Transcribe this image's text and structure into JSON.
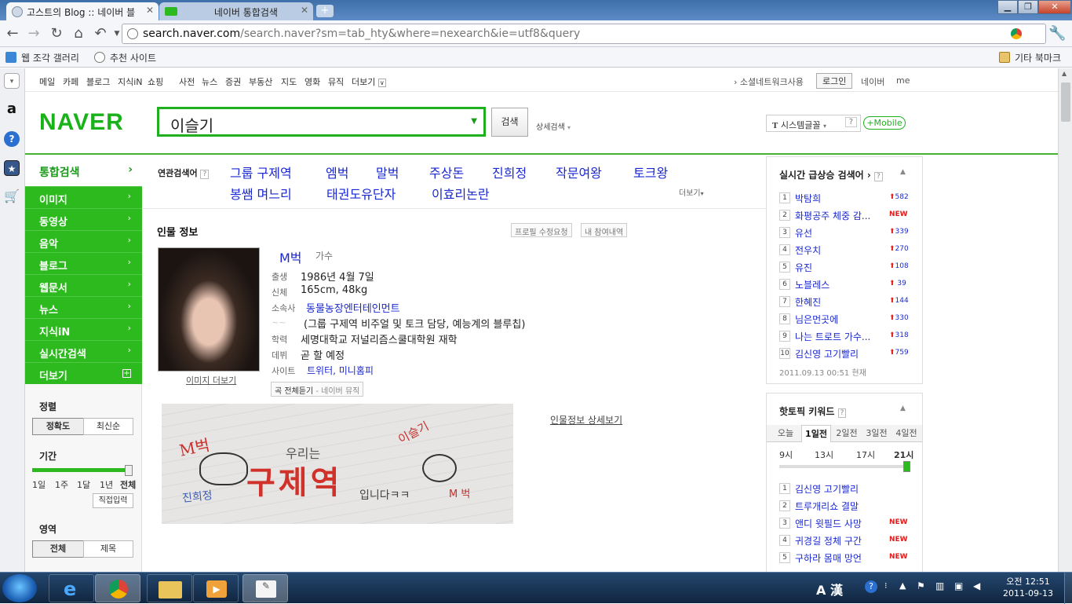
{
  "browser": {
    "tabs": [
      {
        "title": "고스트의 Blog :: 네이버 블",
        "active": true
      },
      {
        "title": "네이버 통합검색",
        "active": false
      }
    ],
    "tab_prefix_hidden": "▭",
    "url_host": "search.naver.com",
    "url_path": "/search.naver?sm=tab_hty&where=nexearch&ie=utf8&query",
    "bookmarks": [
      "웹 조각 갤러리",
      "추천 사이트"
    ],
    "other_bookmarks": "기타 북마크"
  },
  "gnb": {
    "items": [
      "메일",
      "카페",
      "블로그",
      "지식iN",
      "쇼핑",
      "사전",
      "뉴스",
      "증권",
      "부동산",
      "지도",
      "영화",
      "뮤직",
      "더보기"
    ],
    "social": "소셜네트워크사용",
    "login": "로그인",
    "naver": "네이버",
    "me": "me"
  },
  "header": {
    "logo": "NAVER",
    "query": "이슬기",
    "search_button": "검색",
    "detail_search": "상세검색",
    "font_select": "시스템글꼴",
    "help": "?",
    "mobile": "+Mobile"
  },
  "lnb": {
    "top": "통합검색",
    "items": [
      "이미지",
      "동영상",
      "음악",
      "블로그",
      "웹문서",
      "뉴스",
      "지식iN",
      "실시간검색",
      "더보기"
    ],
    "sort_label": "정렬",
    "sort_options": [
      "정확도",
      "최신순"
    ],
    "period_label": "기간",
    "period_ticks": [
      "1일",
      "1주",
      "1달",
      "1년",
      "전체"
    ],
    "direct_input": "직접입력",
    "area_label": "영역",
    "area_options": [
      "전체",
      "제목"
    ]
  },
  "related": {
    "label": "연관검색어",
    "row1": [
      "그룹 구제역",
      "엠벅",
      "말벅",
      "주상돈",
      "진희정",
      "작문여왕",
      "토크왕"
    ],
    "row2": [
      "봉쌤 며느리",
      "태권도유단자",
      "이효리논란"
    ],
    "more": "더보기"
  },
  "profile": {
    "title": "인물 정보",
    "edit_request": "프로필 수정요청",
    "my_history": "내 참여내역",
    "name": "M벅",
    "job": "가수",
    "fields": [
      {
        "key": "출생",
        "value": "1986년 4월 7일",
        "link": false
      },
      {
        "key": "신체",
        "value": "165cm, 48kg",
        "link": false
      },
      {
        "key": "소속사",
        "value": "동물농장엔터테인먼트",
        "link": true
      },
      {
        "key": "",
        "value": "(그룹 구제역 비주얼 및 토크 담당, 예능계의 블루칩)",
        "link": false
      },
      {
        "key": "학력",
        "value": "세명대학교 저널리즘스쿨대학원 재학",
        "link": false
      },
      {
        "key": "데뷔",
        "value": "곧 할 예정",
        "link": false
      },
      {
        "key": "사이트",
        "value": "트위터, 미니홈피",
        "link": true
      }
    ],
    "image_more": "이미지 더보기",
    "listen_all": "곡 전체듣기",
    "listen_src": "- 네이버 뮤직",
    "detail_link": "인물정보 상세보기",
    "drawing_texts": [
      "M벅",
      "우리는",
      "구제역",
      "입니다ㅋㅋ",
      "M 벅",
      "이슬기",
      "진희정"
    ]
  },
  "realtime": {
    "title": "실시간 급상승 검색어",
    "items": [
      {
        "rank": "1",
        "text": "박탐희",
        "change": "582",
        "new": false
      },
      {
        "rank": "2",
        "text": "화평공주 체중 감...",
        "change": "NEW",
        "new": true
      },
      {
        "rank": "3",
        "text": "유선",
        "change": "339",
        "new": false
      },
      {
        "rank": "4",
        "text": "전우치",
        "change": "270",
        "new": false
      },
      {
        "rank": "5",
        "text": "유진",
        "change": "108",
        "new": false
      },
      {
        "rank": "6",
        "text": "노블레스",
        "change": "39",
        "new": false
      },
      {
        "rank": "7",
        "text": "한혜진",
        "change": "144",
        "new": false
      },
      {
        "rank": "8",
        "text": "님은먼곳에",
        "change": "330",
        "new": false
      },
      {
        "rank": "9",
        "text": "나는 트로트 가수...",
        "change": "318",
        "new": false
      },
      {
        "rank": "10",
        "text": "김신영 고기빨리",
        "change": "759",
        "new": false
      }
    ],
    "timestamp": "2011.09.13 00:51 현재"
  },
  "hottopic": {
    "title": "핫토픽 키워드",
    "tabs": [
      "오늘",
      "1일전",
      "2일전",
      "3일전",
      "4일전"
    ],
    "times": [
      "9시",
      "13시",
      "17시",
      "21시"
    ],
    "items": [
      {
        "rank": "1",
        "text": "김신영 고기빨리",
        "new": false
      },
      {
        "rank": "2",
        "text": "트루개리쇼 결말",
        "new": false
      },
      {
        "rank": "3",
        "text": "앤디 윗필드 사망",
        "new": true
      },
      {
        "rank": "4",
        "text": "귀경길 정체 구간",
        "new": true
      },
      {
        "rank": "5",
        "text": "구하라 몸매 망언",
        "new": true
      }
    ],
    "new_label": "NEW"
  },
  "taskbar": {
    "time": "오전 12:51",
    "date": "2011-09-13",
    "ime": "A 漢"
  },
  "colors": {
    "naver_green": "#1fb01f",
    "link_blue": "#1a28d1",
    "up_red": "#e01f1f"
  }
}
